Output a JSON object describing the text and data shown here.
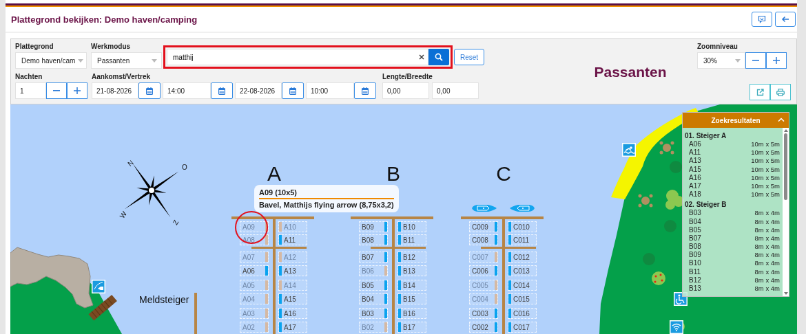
{
  "header": {
    "title": "Plattegrond bekijken: Demo haven/camping"
  },
  "toolbar": {
    "plattegrond": {
      "label": "Plattegrond",
      "value": "Demo haven/cam"
    },
    "werkmodus": {
      "label": "Werkmodus",
      "value": "Passanten"
    },
    "search": {
      "value": "matthij",
      "highlighted": true
    },
    "reset": "Reset",
    "mode_title": "Passanten",
    "zoom": {
      "label": "Zoomniveau",
      "value": "30%"
    },
    "nights": {
      "label": "Nachten",
      "value": "1"
    },
    "arrival_departure": {
      "label": "Aankomst/Vertrek",
      "fields": [
        "21-08-2026",
        "14:00",
        "22-08-2026",
        "10:00"
      ]
    },
    "length_width": {
      "label": "Lengte/Breedte",
      "values": [
        "0,00",
        "0,00"
      ]
    }
  },
  "map": {
    "compass_labels": [
      "N",
      "O",
      "W",
      "Z"
    ],
    "jetty_label": "Meldsteiger",
    "piers": [
      {
        "name": "A",
        "left": [
          {
            "label": "A09",
            "available": false,
            "selected": true
          },
          {
            "label": "A08",
            "available": false,
            "selected": false
          },
          {
            "label": "A07",
            "available": false,
            "selected": false
          },
          {
            "label": "A06",
            "available": true,
            "selected": false
          },
          {
            "label": "A05",
            "available": false,
            "selected": false
          },
          {
            "label": "A04",
            "available": false,
            "selected": false
          },
          {
            "label": "A03",
            "available": false,
            "selected": false
          },
          {
            "label": "A02",
            "available": false,
            "selected": false
          }
        ],
        "right": [
          {
            "label": "A10",
            "available": false,
            "selected": false
          },
          {
            "label": "A11",
            "available": true,
            "selected": false
          },
          {
            "label": "A12",
            "available": false,
            "selected": false
          },
          {
            "label": "A13",
            "available": true,
            "selected": false
          },
          {
            "label": "A14",
            "available": false,
            "selected": false
          },
          {
            "label": "A15",
            "available": true,
            "selected": false
          },
          {
            "label": "A16",
            "available": true,
            "selected": false
          },
          {
            "label": "A17",
            "available": true,
            "selected": false
          }
        ]
      },
      {
        "name": "B",
        "left": [
          {
            "label": "B09",
            "available": true,
            "selected": false
          },
          {
            "label": "B08",
            "available": true,
            "selected": false
          },
          {
            "label": "B07",
            "available": true,
            "selected": false
          },
          {
            "label": "B06",
            "available": false,
            "selected": false
          },
          {
            "label": "B05",
            "available": true,
            "selected": false
          },
          {
            "label": "B04",
            "available": true,
            "selected": false
          },
          {
            "label": "B03",
            "available": true,
            "selected": false
          },
          {
            "label": "B02",
            "available": false,
            "selected": false
          }
        ],
        "right": [
          {
            "label": "B10",
            "available": true,
            "selected": false
          },
          {
            "label": "B11",
            "available": true,
            "selected": false
          },
          {
            "label": "B12",
            "available": true,
            "selected": false
          },
          {
            "label": "B13",
            "available": true,
            "selected": false
          },
          {
            "label": "B14",
            "available": true,
            "selected": false
          },
          {
            "label": "B15",
            "available": true,
            "selected": false
          },
          {
            "label": "B16",
            "available": true,
            "selected": false
          },
          {
            "label": "B17",
            "available": true,
            "selected": false
          }
        ]
      },
      {
        "name": "C",
        "left": [
          {
            "label": "C009",
            "available": true,
            "selected": false
          },
          {
            "label": "C008",
            "available": true,
            "selected": false
          },
          {
            "label": "C007",
            "available": false,
            "selected": false
          },
          {
            "label": "C006",
            "available": true,
            "selected": false
          },
          {
            "label": "C005",
            "available": false,
            "selected": false
          },
          {
            "label": "C004",
            "available": false,
            "selected": false
          },
          {
            "label": "C003",
            "available": true,
            "selected": false
          },
          {
            "label": "C002",
            "available": true,
            "selected": false
          }
        ],
        "right": [
          {
            "label": "C010",
            "available": true,
            "selected": false
          },
          {
            "label": "C011",
            "available": true,
            "selected": false
          },
          {
            "label": "C012",
            "available": true,
            "selected": false
          },
          {
            "label": "C013",
            "available": true,
            "selected": false
          },
          {
            "label": "C014",
            "available": true,
            "selected": false
          },
          {
            "label": "C015",
            "available": true,
            "selected": false
          },
          {
            "label": "C016",
            "available": true,
            "selected": false
          },
          {
            "label": "C017",
            "available": true,
            "selected": false
          }
        ]
      }
    ],
    "tooltip": {
      "title": "A09 (10x5)",
      "detail": "Bavel, Matthijs flying arrow (8,75x3,2)"
    }
  },
  "results": {
    "title": "Zoekresultaten",
    "expanded": true,
    "groups": [
      {
        "name": "01. Steiger A",
        "items": [
          {
            "berth": "A06",
            "size": "10m x 5m"
          },
          {
            "berth": "A11",
            "size": "10m x 5m"
          },
          {
            "berth": "A13",
            "size": "10m x 5m"
          },
          {
            "berth": "A15",
            "size": "10m x 5m"
          },
          {
            "berth": "A16",
            "size": "10m x 5m"
          },
          {
            "berth": "A17",
            "size": "10m x 5m"
          },
          {
            "berth": "A18",
            "size": "10m x 5m"
          }
        ]
      },
      {
        "name": "02. Steiger B",
        "items": [
          {
            "berth": "B03",
            "size": "8m x 4m"
          },
          {
            "berth": "B04",
            "size": "8m x 4m"
          },
          {
            "berth": "B05",
            "size": "8m x 4m"
          },
          {
            "berth": "B07",
            "size": "8m x 4m"
          },
          {
            "berth": "B08",
            "size": "8m x 4m"
          },
          {
            "berth": "B09",
            "size": "8m x 4m"
          },
          {
            "berth": "B10",
            "size": "8m x 4m"
          },
          {
            "berth": "B11",
            "size": "8m x 4m"
          },
          {
            "berth": "B12",
            "size": "8m x 4m"
          },
          {
            "berth": "B13",
            "size": "8m x 4m"
          }
        ]
      }
    ]
  }
}
